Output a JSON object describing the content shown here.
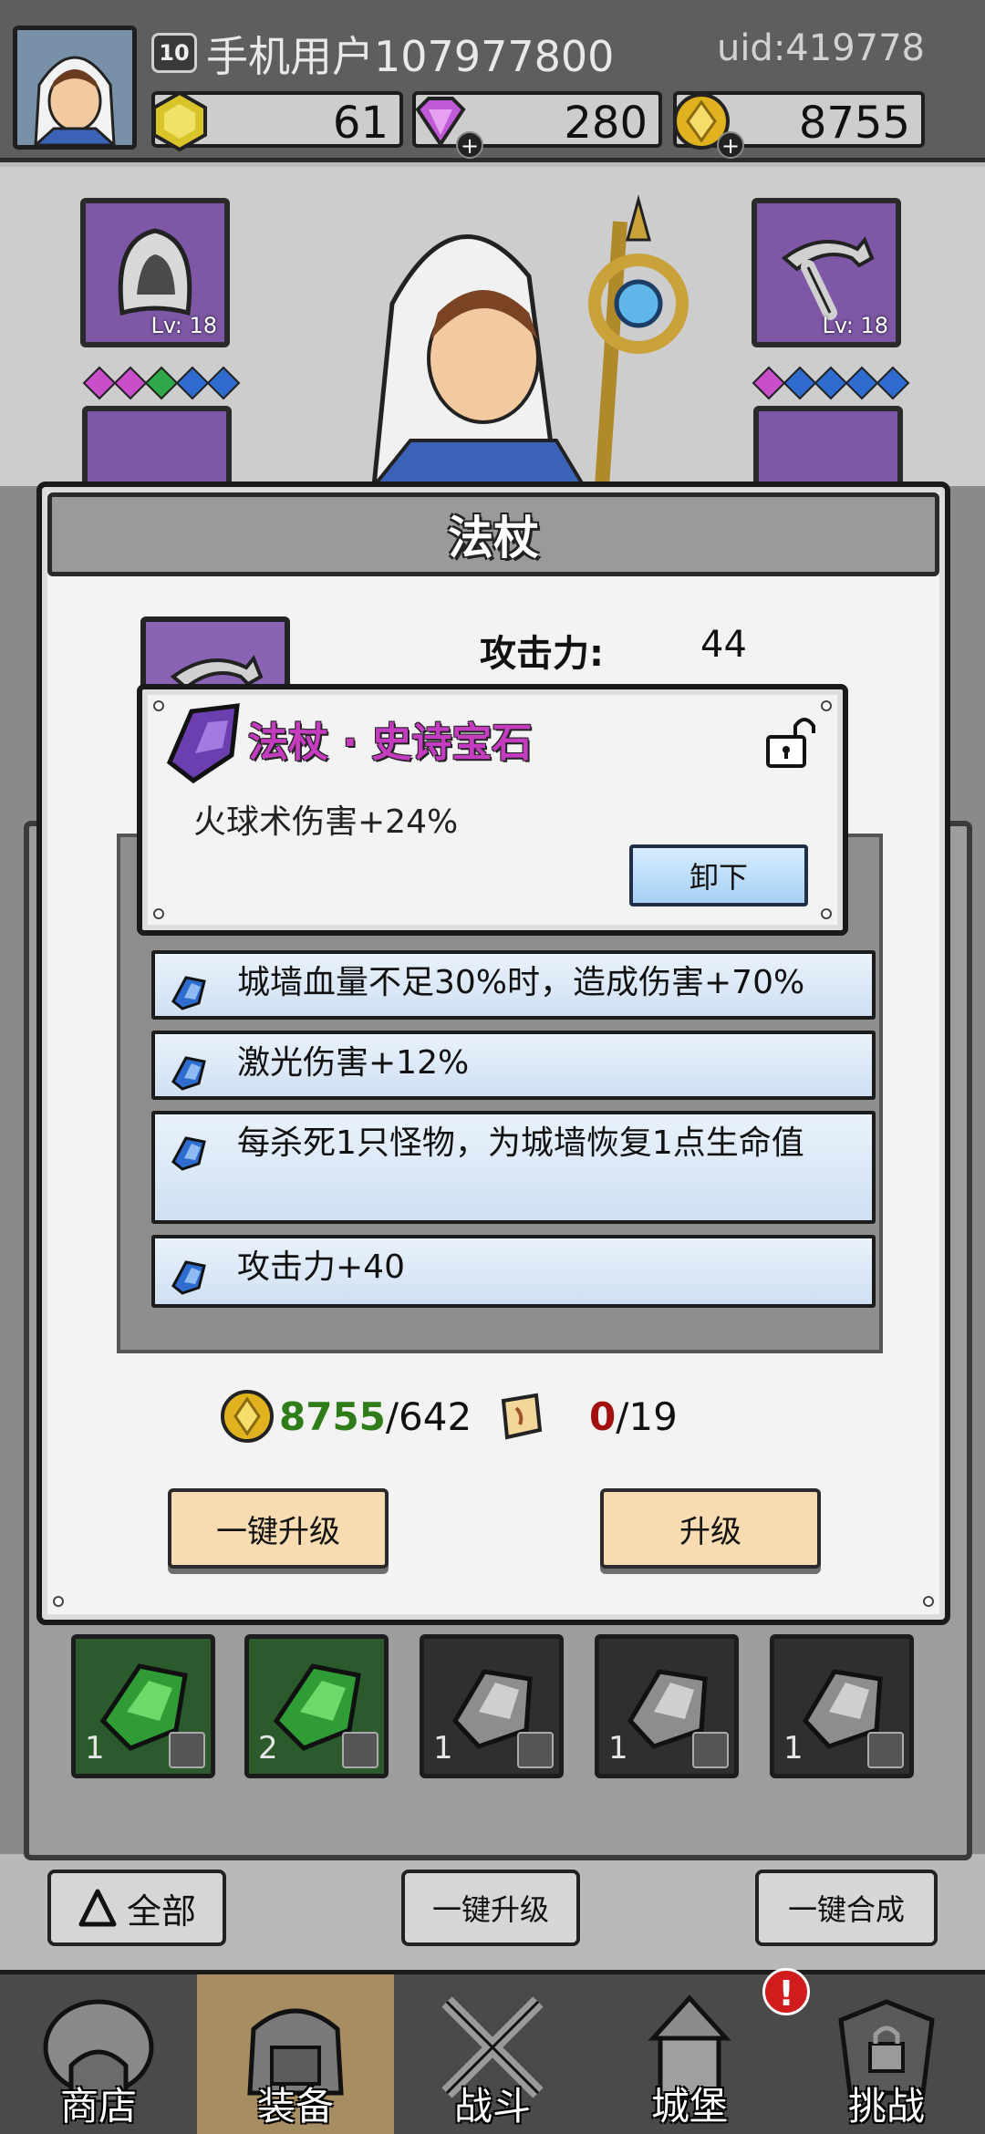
{
  "header": {
    "level": "10",
    "username": "手机用户107977800",
    "uid": "uid:419778",
    "resources": [
      {
        "name": "gold-gem",
        "value": "61"
      },
      {
        "name": "diamond",
        "value": "280"
      },
      {
        "name": "coin",
        "value": "8755"
      }
    ],
    "plus_symbol": "+"
  },
  "equip_slots": {
    "left_top_level": "Lv: 18",
    "right_top_level": "Lv: 18"
  },
  "dialog": {
    "title": "法杖",
    "stat_label": "攻击力:",
    "stat_value": "44",
    "attributes": [
      "城墙血量不足30%时，造成伤害+70%",
      "激光伤害+12%",
      "每杀死1只怪物，为城墙恢复1点生命值",
      "攻击力+40"
    ],
    "cost_coin_have": "8755",
    "cost_coin_need": "/642",
    "cost_scroll_have": "0",
    "cost_scroll_need": "/19",
    "upgrade_all_label": "一键升级",
    "upgrade_label": "升级"
  },
  "gem_popup": {
    "title": "法杖 · 史诗宝石",
    "description": "火球术伤害+24%",
    "unequip_label": "卸下"
  },
  "inventory": {
    "items": [
      {
        "count": "1",
        "kind": "green"
      },
      {
        "count": "2",
        "kind": "green"
      },
      {
        "count": "1",
        "kind": "grey"
      },
      {
        "count": "1",
        "kind": "grey"
      },
      {
        "count": "1",
        "kind": "grey"
      }
    ]
  },
  "bottom_buttons": {
    "filter_label": "全部",
    "upgrade_all_label": "一键升级",
    "merge_all_label": "一键合成"
  },
  "tabs": [
    {
      "label": "商店"
    },
    {
      "label": "装备"
    },
    {
      "label": "战斗"
    },
    {
      "label": "城堡"
    },
    {
      "label": "挑战"
    }
  ],
  "alert_badge": "!",
  "colors": {
    "gem_title": "#c43dc0",
    "coin_have": "#2e7d18",
    "scroll_have": "#a21010",
    "slot_purple": "#7e57a7"
  }
}
